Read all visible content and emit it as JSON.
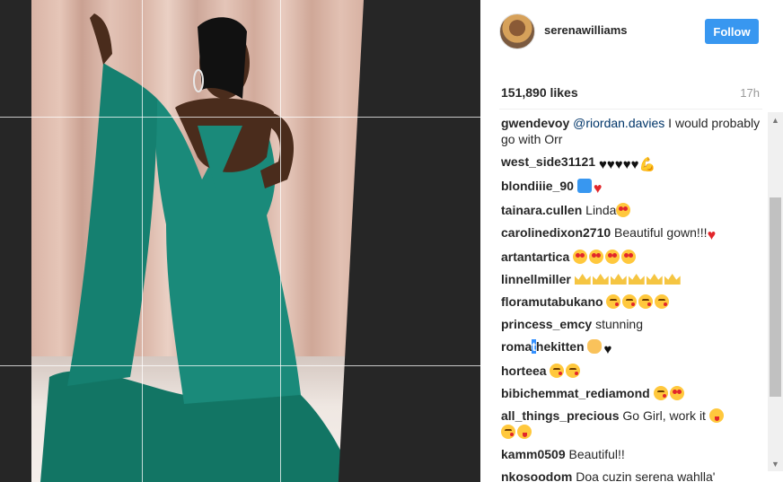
{
  "post": {
    "username": "serenawilliams",
    "follow_label": "Follow",
    "likes": "151,890 likes",
    "time": "17h"
  },
  "comments": [
    {
      "user": "gwendevoy",
      "mention": "@riordan.davies",
      "text": " I would probably go with Orr"
    },
    {
      "user": "west_side31121",
      "text": ""
    },
    {
      "user": "blondiiie_90",
      "text": ""
    },
    {
      "user": "tainara.cullen",
      "text": " Linda"
    },
    {
      "user": "carolinedixon2710",
      "text": " Beautiful gown!!!"
    },
    {
      "user": "artantartica",
      "text": ""
    },
    {
      "user": "linnellmiller",
      "text": ""
    },
    {
      "user": "floramutabukano",
      "text": ""
    },
    {
      "user": "princess_emcy",
      "text": " stunning"
    },
    {
      "user_a": "roma",
      "user_sel": "t",
      "user_b": "hekitten",
      "text": ""
    },
    {
      "user": "horteea",
      "text": ""
    },
    {
      "user": "bibichemmat_rediamond",
      "text": ""
    },
    {
      "user": "all_things_precious",
      "text": " Go Girl, work it "
    },
    {
      "user": "kamm0509",
      "text": " Beautiful!!"
    },
    {
      "user": "nkosoodom",
      "text": " Doa cuzin serena wahlla'"
    }
  ],
  "icons": {
    "heart_black": "♥",
    "heart_red": "♥",
    "muscle": "💪",
    "scroll_up": "▲",
    "scroll_down": "▼"
  },
  "colors": {
    "follow_bg": "#3897f0",
    "mention": "#003569",
    "dress": "#1a8a7a"
  }
}
